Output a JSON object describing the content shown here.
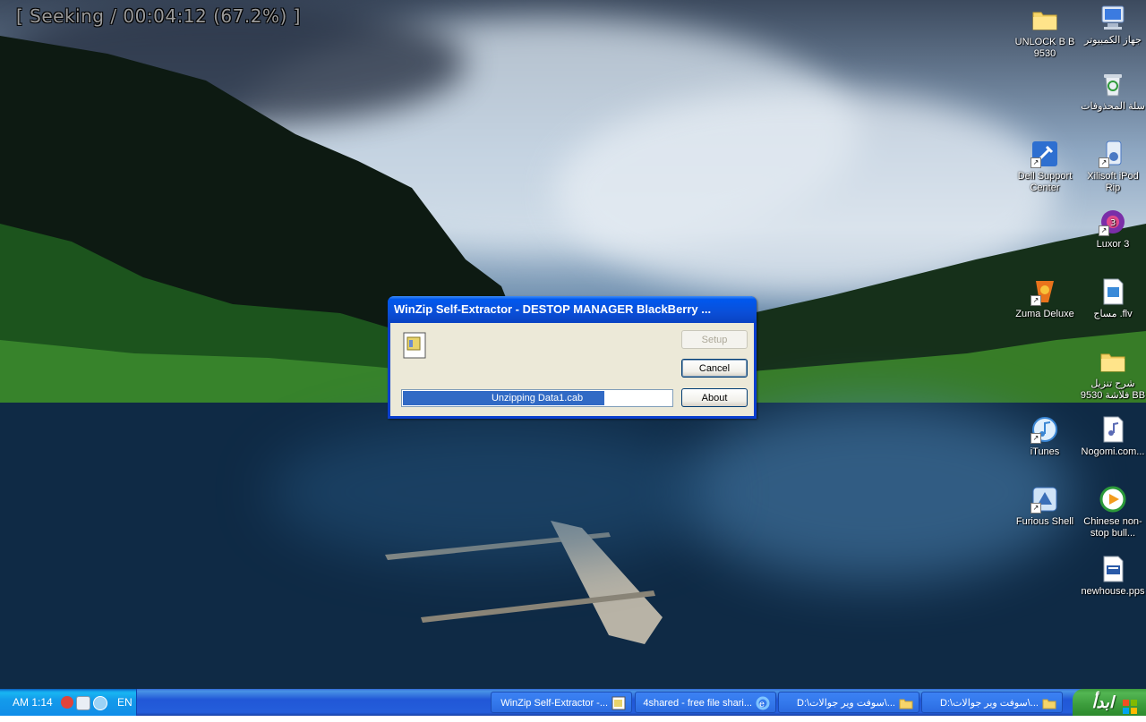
{
  "osd": {
    "text": "[ Seeking / 00:04:12 (67.2%) ]"
  },
  "desktop_icons": [
    {
      "label": "جهاز الكمبيوتر",
      "icon": "my-computer-icon"
    },
    {
      "label": "UNLOCK B B 9530",
      "icon": "folder-icon"
    },
    {
      "label": "سلة المحذوفات",
      "icon": "recycle-bin-icon"
    },
    {
      "label": "Xilisoft iPod Rip",
      "icon": "xilisoft-icon"
    },
    {
      "label": "Dell Support Center",
      "icon": "dell-support-icon"
    },
    {
      "label": "Luxor 3",
      "icon": "luxor-icon"
    },
    {
      "label": "مساج .flv",
      "icon": "flv-file-icon"
    },
    {
      "label": "Zuma Deluxe",
      "icon": "zuma-icon"
    },
    {
      "label": "شرح تنزيل فلاشة 9530 BB",
      "icon": "folder-icon"
    },
    {
      "label": "Nogomi.com...",
      "icon": "mp3-file-icon"
    },
    {
      "label": "iTunes",
      "icon": "itunes-icon"
    },
    {
      "label": "Chinese non-stop bull...",
      "icon": "media-player-icon"
    },
    {
      "label": "Furious Shell",
      "icon": "furious-shell-icon"
    },
    {
      "label": "newhouse.pps",
      "icon": "pps-file-icon"
    }
  ],
  "dialog": {
    "title": "WinZip Self-Extractor - DESTOP MANAGER BlackBerry ...",
    "buttons": {
      "setup": "Setup",
      "cancel": "Cancel",
      "about": "About"
    },
    "progress_text": "Unzipping Data1.cab",
    "progress_fraction": 0.75
  },
  "taskbar": {
    "clock": "AM 1:14",
    "language": "EN",
    "start_label": "ابدأ",
    "tasks": [
      {
        "label": "WinZip Self-Extractor -...",
        "icon": "winzip-icon"
      },
      {
        "label": "4shared - free file shari...",
        "icon": "ie-icon"
      },
      {
        "label": "D:\\سوفت وير جوالات\\...",
        "icon": "folder-icon"
      },
      {
        "label": "D:\\سوفت وير جوالات\\...",
        "icon": "folder-icon"
      }
    ]
  },
  "colors": {
    "xp_title_blue": "#0058ee",
    "taskbar_blue": "#245edb",
    "start_green": "#3c9c3c",
    "dialog_face": "#ece9d8",
    "progress_fill": "#316ac5"
  }
}
